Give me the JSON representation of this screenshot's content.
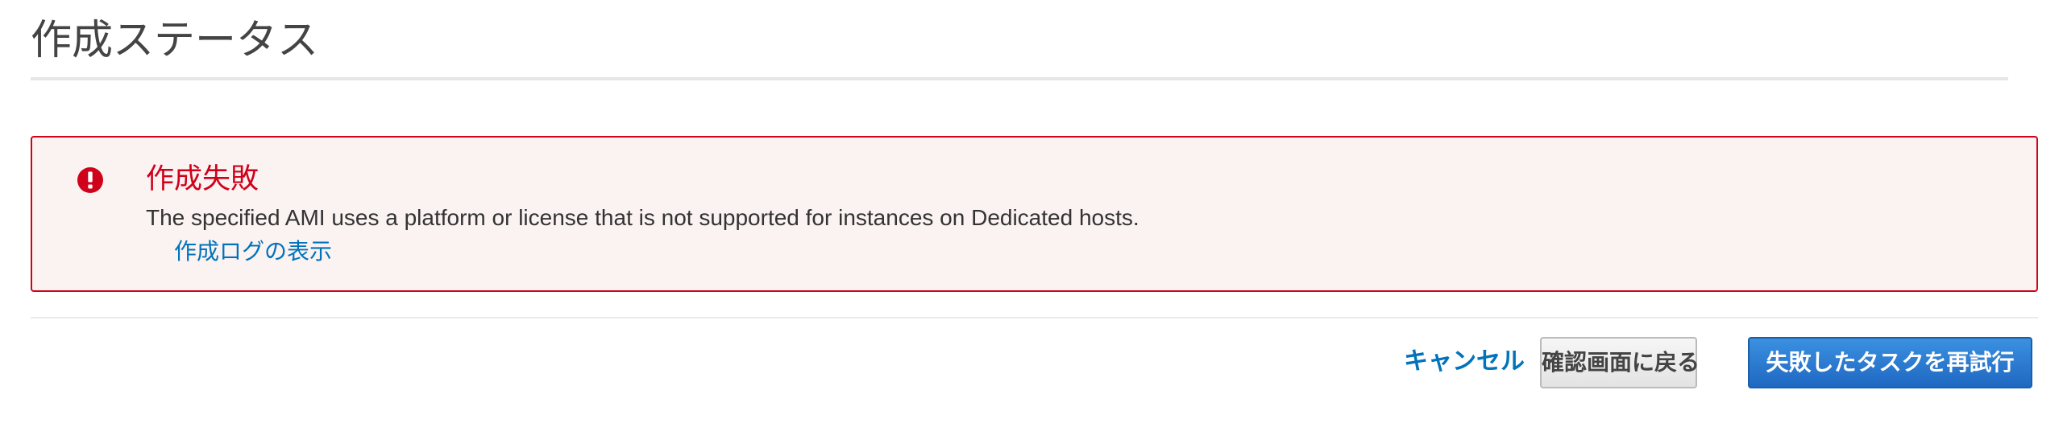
{
  "page": {
    "title": "作成ステータス"
  },
  "alert": {
    "icon": "error-exclamation-icon",
    "title": "作成失敗",
    "message": "The specified AMI uses a platform or license that is not supported for instances on Dedicated hosts.",
    "log_link": "作成ログの表示",
    "border_color": "#d0021b",
    "background_color": "#fbf2f2"
  },
  "actions": {
    "cancel_label": "キャンセル",
    "back_label": "確認画面に戻る",
    "retry_label": "失敗したタスクを再試行"
  },
  "colors": {
    "link": "#0073bb",
    "primary_button": "#1f68c2",
    "error": "#d0021b"
  }
}
